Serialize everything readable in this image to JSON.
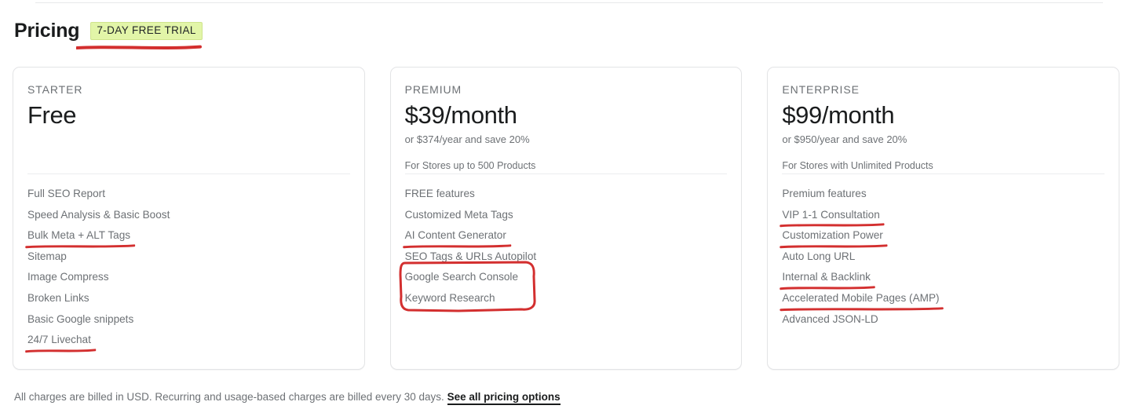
{
  "header": {
    "title": "Pricing",
    "badge": "7-DAY FREE TRIAL"
  },
  "colors": {
    "annotation_red": "#d32f2f",
    "badge_background": "#e2f5a8",
    "text_muted": "#6d7175",
    "text_dark": "#1a1c1d"
  },
  "plans": [
    {
      "name": "STARTER",
      "price": "Free",
      "price_sub": "",
      "note": "",
      "features": [
        {
          "label": "Full SEO Report",
          "annotation": "none"
        },
        {
          "label": "Speed Analysis & Basic Boost",
          "annotation": "none"
        },
        {
          "label": "Bulk Meta + ALT Tags",
          "annotation": "underline"
        },
        {
          "label": "Sitemap",
          "annotation": "none"
        },
        {
          "label": "Image Compress",
          "annotation": "none"
        },
        {
          "label": "Broken Links",
          "annotation": "none"
        },
        {
          "label": "Basic Google snippets",
          "annotation": "none"
        },
        {
          "label": "24/7 Livechat",
          "annotation": "underline"
        }
      ]
    },
    {
      "name": "PREMIUM",
      "price": "$39/month",
      "price_sub": "or $374/year and save 20%",
      "note": "For Stores up to 500 Products",
      "features": [
        {
          "label": "FREE features",
          "annotation": "none"
        },
        {
          "label": "Customized Meta Tags",
          "annotation": "none"
        },
        {
          "label": "AI Content Generator",
          "annotation": "underline"
        },
        {
          "label": "SEO Tags & URLs Autopilot",
          "annotation": "none"
        },
        {
          "label": "Google Search Console",
          "annotation": "box"
        },
        {
          "label": "Keyword Research",
          "annotation": "box"
        }
      ]
    },
    {
      "name": "ENTERPRISE",
      "price": "$99/month",
      "price_sub": "or $950/year and save 20%",
      "note": "For Stores with Unlimited Products",
      "features": [
        {
          "label": "Premium features",
          "annotation": "none"
        },
        {
          "label": "VIP 1-1 Consultation",
          "annotation": "underline"
        },
        {
          "label": "Customization Power",
          "annotation": "underline"
        },
        {
          "label": "Auto Long URL",
          "annotation": "none"
        },
        {
          "label": "Internal & Backlink",
          "annotation": "underline"
        },
        {
          "label": "Accelerated Mobile Pages (AMP)",
          "annotation": "underline"
        },
        {
          "label": "Advanced JSON-LD",
          "annotation": "none"
        }
      ]
    }
  ],
  "footer": {
    "text": "All charges are billed in USD. Recurring and usage-based charges are billed every 30 days.",
    "link": "See all pricing options"
  }
}
